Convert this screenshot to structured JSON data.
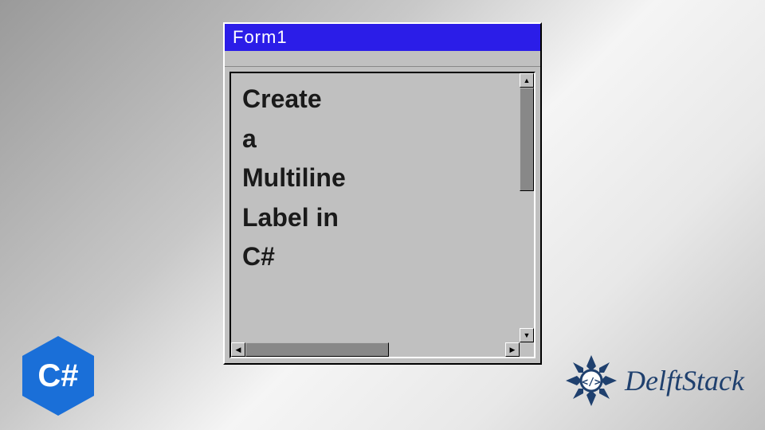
{
  "window": {
    "title": "Form1"
  },
  "label": {
    "text": "Create\na\nMultiline\nLabel in\nC#"
  },
  "badges": {
    "csharp": "C#",
    "brand": "DelftStack"
  },
  "icons": {
    "up": "▲",
    "down": "▼",
    "left": "◀",
    "right": "▶"
  }
}
